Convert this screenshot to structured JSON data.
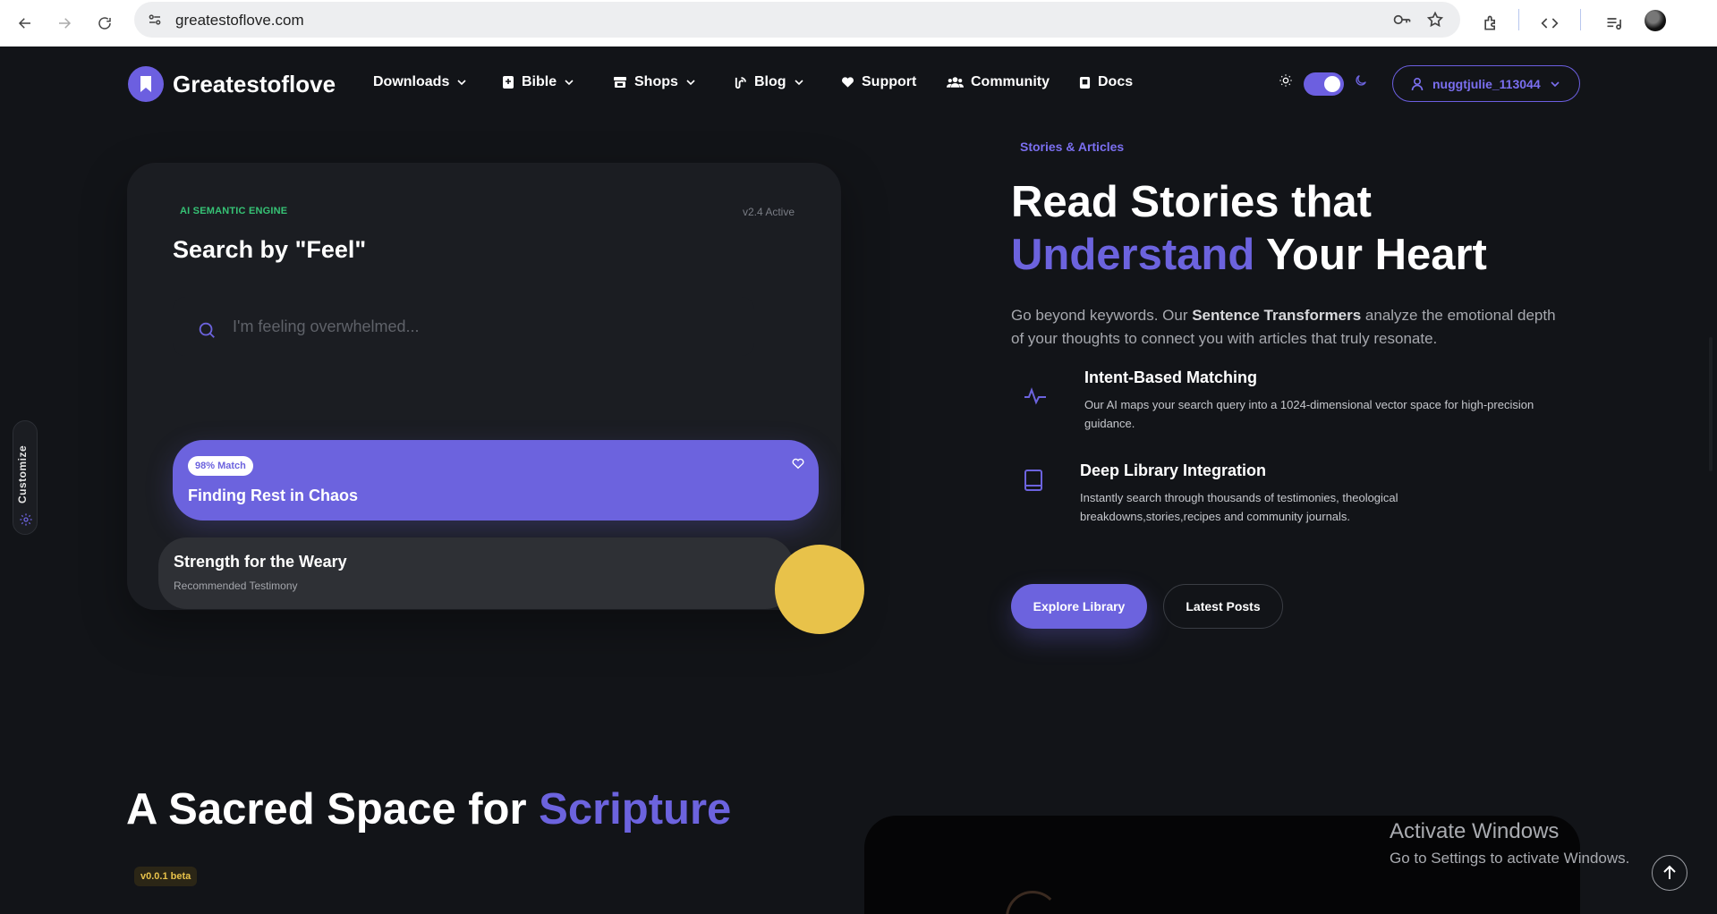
{
  "browser": {
    "url": "greatestoflove.com"
  },
  "header": {
    "logo_text": "Greatestoflove",
    "nav": [
      {
        "label": "Downloads",
        "icon": "",
        "dropdown": true
      },
      {
        "label": "Bible",
        "icon": "book-icon",
        "dropdown": true
      },
      {
        "label": "Shops",
        "icon": "store-icon",
        "dropdown": true
      },
      {
        "label": "Blog",
        "icon": "blog-icon",
        "dropdown": true
      },
      {
        "label": "Support",
        "icon": "heart-icon",
        "dropdown": false
      },
      {
        "label": "Community",
        "icon": "users-icon",
        "dropdown": false
      },
      {
        "label": "Docs",
        "icon": "docs-icon",
        "dropdown": false
      }
    ],
    "user": "nuggtjulie_113044"
  },
  "search_card": {
    "engine_label": "AI SEMANTIC ENGINE",
    "version": "v2.4 Active",
    "title": "Search by \"Feel\"",
    "placeholder": "I'm feeling overwhelmed...",
    "results": [
      {
        "badge": "98% Match",
        "title": "Finding Rest in Chaos"
      },
      {
        "title": "Strength for the Weary",
        "subtitle": "Recommended Testimony"
      }
    ]
  },
  "customize": {
    "label": "Customize"
  },
  "hero": {
    "eyebrow": "Stories & Articles",
    "title_line1": "Read Stories that",
    "title_accent": "Understand",
    "title_rest": "Your Heart",
    "desc_prefix": "Go beyond keywords. Our ",
    "desc_bold": "Sentence Transformers",
    "desc_suffix": " analyze the emotional depth of your thoughts to connect you with articles that truly resonate.",
    "features": [
      {
        "title": "Intent-Based Matching",
        "desc": "Our AI maps your search query into a 1024-dimensional vector space for high-precision guidance.",
        "icon": "activity-icon"
      },
      {
        "title": "Deep Library Integration",
        "desc": "Instantly search through thousands of testimonies, theological breakdowns,stories,recipes and community journals.",
        "icon": "book-open-icon"
      }
    ],
    "primary_button": "Explore Library",
    "secondary_button": "Latest Posts"
  },
  "scripture": {
    "title_prefix": "A Sacred Space for",
    "title_accent": "Scripture",
    "badge": "v0.0.1 beta"
  },
  "watermark": {
    "line1": "Activate Windows",
    "line2": "Go to Settings to activate Windows."
  },
  "colors": {
    "accent": "#6c63de",
    "background": "#121418",
    "card": "#1b1d22",
    "green": "#36c275",
    "yellow": "#e8c24a"
  }
}
